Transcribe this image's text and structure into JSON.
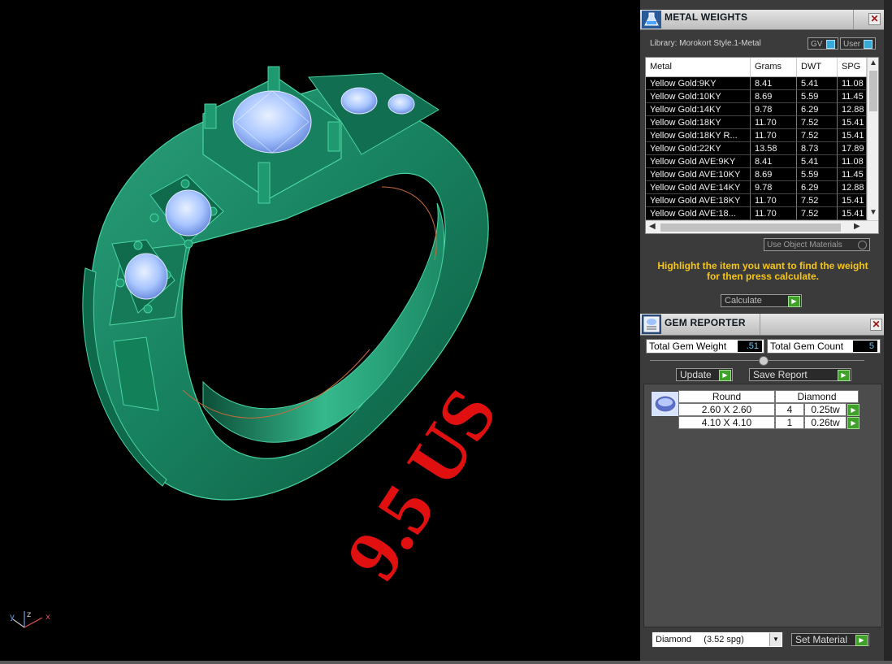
{
  "viewport": {
    "size_text": "9.5 US",
    "axis": {
      "y": "y",
      "z": "z",
      "x": "x"
    }
  },
  "metal_weights": {
    "title": "METAL WEIGHTS",
    "library": "Library: Morokort Style.1-Metal",
    "toggles": {
      "gv": "GV",
      "user": "User"
    },
    "columns": [
      "Metal",
      "Grams",
      "DWT",
      "SPG"
    ],
    "rows": [
      {
        "metal": "Yellow Gold:9KY",
        "grams": "8.41",
        "dwt": "5.41",
        "spg": "11.08"
      },
      {
        "metal": "Yellow Gold:10KY",
        "grams": "8.69",
        "dwt": "5.59",
        "spg": "11.45"
      },
      {
        "metal": "Yellow Gold:14KY",
        "grams": "9.78",
        "dwt": "6.29",
        "spg": "12.88"
      },
      {
        "metal": "Yellow Gold:18KY",
        "grams": "11.70",
        "dwt": "7.52",
        "spg": "15.41"
      },
      {
        "metal": "Yellow Gold:18KY R...",
        "grams": "11.70",
        "dwt": "7.52",
        "spg": "15.41"
      },
      {
        "metal": "Yellow Gold:22KY",
        "grams": "13.58",
        "dwt": "8.73",
        "spg": "17.89"
      },
      {
        "metal": "Yellow Gold AVE:9KY",
        "grams": "8.41",
        "dwt": "5.41",
        "spg": "11.08"
      },
      {
        "metal": "Yellow Gold AVE:10KY",
        "grams": "8.69",
        "dwt": "5.59",
        "spg": "11.45"
      },
      {
        "metal": "Yellow Gold AVE:14KY",
        "grams": "9.78",
        "dwt": "6.29",
        "spg": "12.88"
      },
      {
        "metal": "Yellow Gold AVE:18KY",
        "grams": "11.70",
        "dwt": "7.52",
        "spg": "15.41"
      },
      {
        "metal": "Yellow Gold AVE:18...",
        "grams": "11.70",
        "dwt": "7.52",
        "spg": "15.41"
      }
    ],
    "use_object_materials": "Use Object Materials",
    "instruction_line1": "Highlight the item you want to find the weight",
    "instruction_line2": "for then press calculate.",
    "calculate_label": "Calculate",
    "instruction_color": "#f5c518"
  },
  "gem_reporter": {
    "title": "GEM REPORTER",
    "total_weight_label": "Total Gem Weight",
    "total_weight_value": ".51",
    "total_count_label": "Total Gem Count",
    "total_count_value": "5",
    "update_label": "Update",
    "save_report_label": "Save Report",
    "table": {
      "shape": "Round",
      "material": "Diamond",
      "rows": [
        {
          "size": "2.60 X 2.60",
          "count": "4",
          "weight": "0.25tw"
        },
        {
          "size": "4.10 X 4.10",
          "count": "1",
          "weight": "0.26tw"
        }
      ]
    },
    "material_select": "Diamond     (3.52 spg)",
    "set_material_label": "Set Material"
  },
  "colors": {
    "ring_green": "#1f8f66",
    "text_red": "#e01010",
    "gem_blue": "#9ec2ff",
    "accent_green": "#3fa02a",
    "value_cyan": "#6ac8f0"
  }
}
